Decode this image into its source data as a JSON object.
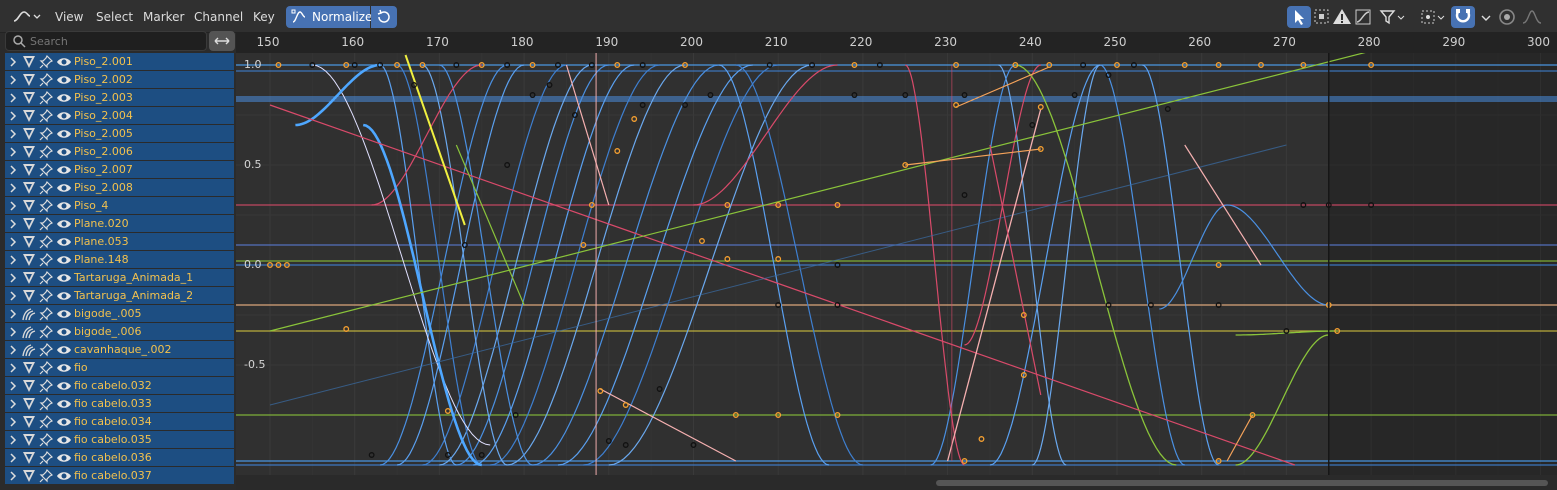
{
  "menu": [
    "View",
    "Select",
    "Marker",
    "Channel",
    "Key"
  ],
  "normalize_label": "Normalize",
  "search": {
    "placeholder": "Search"
  },
  "ruler": {
    "labels": [
      "150",
      "160",
      "170",
      "180",
      "190",
      "200",
      "210",
      "220",
      "230",
      "240",
      "250",
      "260",
      "270",
      "280",
      "290",
      "300"
    ]
  },
  "value_axis": [
    "1.0",
    "0.5",
    "0.0",
    "-0.5"
  ],
  "current_frame": 275,
  "channels": [
    {
      "label": "Piso_2.001",
      "kind": "mesh"
    },
    {
      "label": "Piso_2.002",
      "kind": "mesh"
    },
    {
      "label": "Piso_2.003",
      "kind": "mesh"
    },
    {
      "label": "Piso_2.004",
      "kind": "mesh"
    },
    {
      "label": "Piso_2.005",
      "kind": "mesh"
    },
    {
      "label": "Piso_2.006",
      "kind": "mesh"
    },
    {
      "label": "Piso_2.007",
      "kind": "mesh"
    },
    {
      "label": "Piso_2.008",
      "kind": "mesh"
    },
    {
      "label": "Piso_4",
      "kind": "mesh"
    },
    {
      "label": "Plane.020",
      "kind": "mesh"
    },
    {
      "label": "Plane.053",
      "kind": "mesh"
    },
    {
      "label": "Plane.148",
      "kind": "mesh"
    },
    {
      "label": "Tartaruga_Animada_1",
      "kind": "mesh"
    },
    {
      "label": "Tartaruga_Animada_2",
      "kind": "mesh"
    },
    {
      "label": "bigode_.005",
      "kind": "hair"
    },
    {
      "label": "bigode_.006",
      "kind": "hair"
    },
    {
      "label": "cavanhaque_.002",
      "kind": "hair"
    },
    {
      "label": "fio",
      "kind": "mesh"
    },
    {
      "label": "fio cabelo.032",
      "kind": "mesh"
    },
    {
      "label": "fio cabelo.033",
      "kind": "mesh"
    },
    {
      "label": "fio cabelo.034",
      "kind": "mesh"
    },
    {
      "label": "fio cabelo.035",
      "kind": "mesh"
    },
    {
      "label": "fio cabelo.036",
      "kind": "mesh"
    },
    {
      "label": "fio cabelo.037",
      "kind": "mesh"
    }
  ],
  "colors": {
    "accent": "#4772b3",
    "channel_bg": "#1d4e82",
    "channel_text": "#f2c14e",
    "playhead": "#4a90d9"
  }
}
